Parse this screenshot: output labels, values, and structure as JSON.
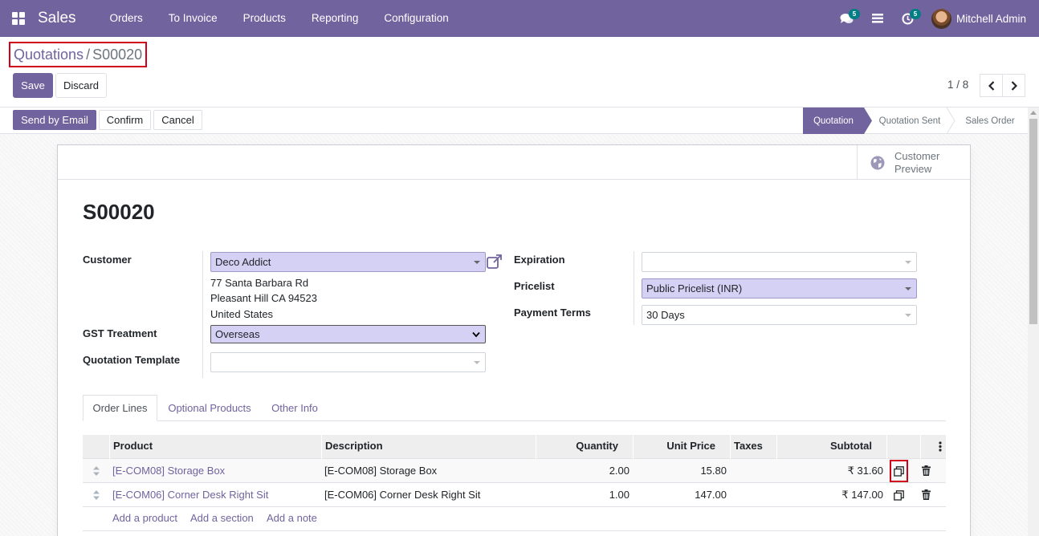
{
  "navbar": {
    "brand": "Sales",
    "menu": [
      "Orders",
      "To Invoice",
      "Products",
      "Reporting",
      "Configuration"
    ],
    "messages_badge": "5",
    "activities_badge": "5",
    "user_name": "Mitchell Admin"
  },
  "control_panel": {
    "breadcrumb_parent": "Quotations",
    "breadcrumb_sep": "/",
    "breadcrumb_current": "S00020",
    "save_label": "Save",
    "discard_label": "Discard",
    "pager": "1 / 8"
  },
  "statusbar": {
    "buttons": [
      "Send by Email",
      "Confirm",
      "Cancel"
    ],
    "stages": [
      "Quotation",
      "Quotation Sent",
      "Sales Order"
    ],
    "active_stage": "Quotation"
  },
  "sheet": {
    "smart_button_line1": "Customer",
    "smart_button_line2": "Preview",
    "title": "S00020",
    "left_fields": {
      "customer_label": "Customer",
      "customer_value": "Deco Addict",
      "address_lines": [
        "77 Santa Barbara Rd",
        "Pleasant Hill CA 94523",
        "United States"
      ],
      "gst_label": "GST Treatment",
      "gst_value": "Overseas",
      "template_label": "Quotation Template",
      "template_value": ""
    },
    "right_fields": {
      "expiration_label": "Expiration",
      "expiration_value": "",
      "pricelist_label": "Pricelist",
      "pricelist_value": "Public Pricelist (INR)",
      "payment_terms_label": "Payment Terms",
      "payment_terms_value": "30 Days"
    },
    "tabs": [
      "Order Lines",
      "Optional Products",
      "Other Info"
    ],
    "table": {
      "headers": [
        "Product",
        "Description",
        "Quantity",
        "Unit Price",
        "Taxes",
        "Subtotal"
      ],
      "rows": [
        {
          "product": "[E-COM08] Storage Box",
          "description": "[E-COM08] Storage Box",
          "quantity": "2.00",
          "unit_price": "15.80",
          "taxes": "",
          "subtotal": "₹ 31.60"
        },
        {
          "product": "[E-COM06] Corner Desk Right Sit",
          "description": "[E-COM06] Corner Desk Right Sit",
          "quantity": "1.00",
          "unit_price": "147.00",
          "taxes": "",
          "subtotal": "₹ 147.00"
        }
      ],
      "add_links": [
        "Add a product",
        "Add a section",
        "Add a note"
      ]
    }
  },
  "colors": {
    "brand": "#71639e",
    "badge": "#017e84",
    "highlight_field": "#d5d1f5",
    "annotation_red": "#d0021b"
  }
}
